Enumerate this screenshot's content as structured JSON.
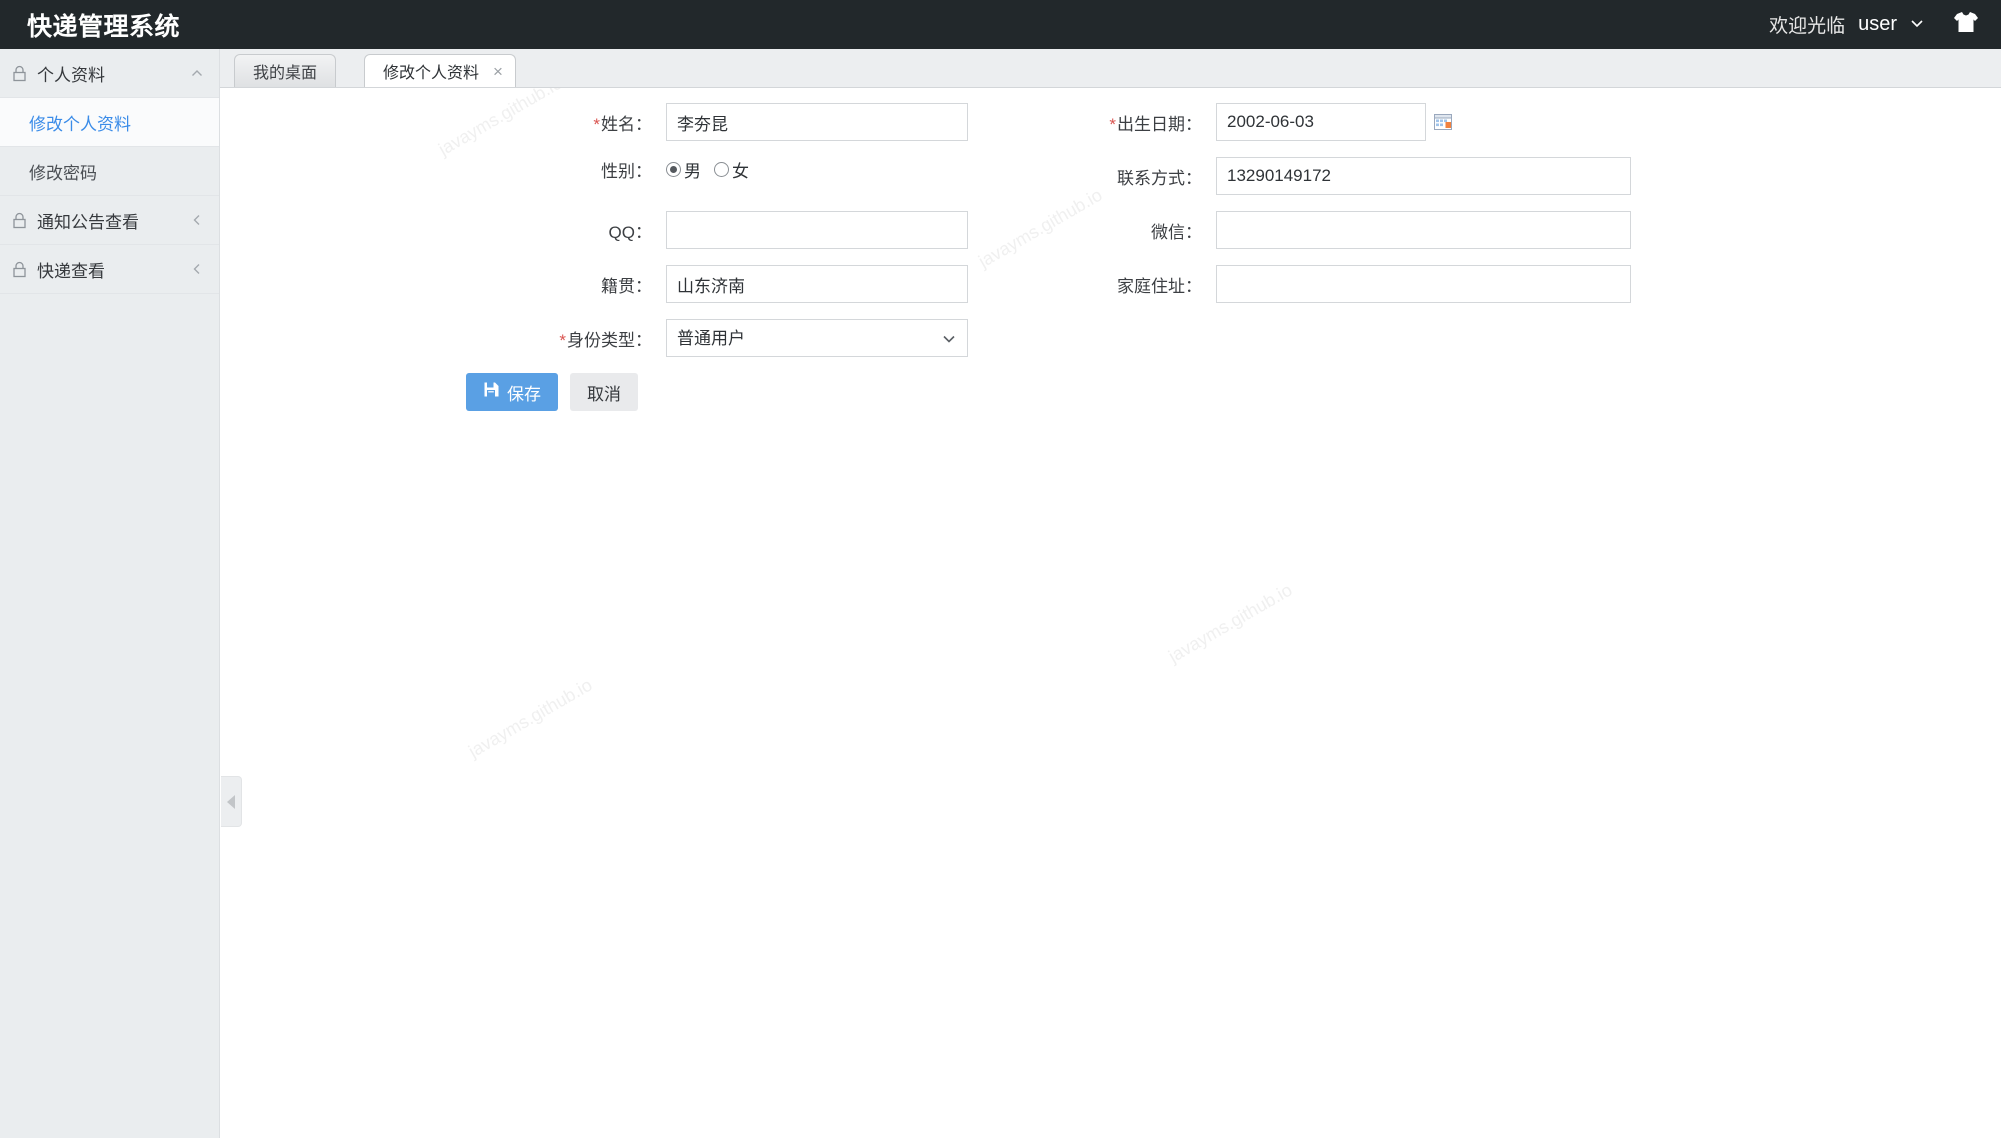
{
  "header": {
    "brand": "快递管理系统",
    "welcome": "欢迎光临",
    "user": "user",
    "caret_icon": "chevron-down-icon",
    "theme_icon": "shirt-icon"
  },
  "sidebar": {
    "groups": [
      {
        "label": "个人资料",
        "icon": "lock-icon",
        "arrow": "⌃",
        "expanded": true,
        "children": [
          {
            "label": "修改个人资料",
            "active": true
          },
          {
            "label": "修改密码",
            "active": false
          }
        ]
      },
      {
        "label": "通知公告查看",
        "icon": "lock-icon",
        "arrow": "＜",
        "expanded": false,
        "children": []
      },
      {
        "label": "快递查看",
        "icon": "lock-icon",
        "arrow": "＜",
        "expanded": false,
        "children": []
      }
    ]
  },
  "tabs": [
    {
      "label": "我的桌面",
      "active": false,
      "closable": false
    },
    {
      "label": "修改个人资料",
      "active": true,
      "closable": true,
      "close_glyph": "×"
    }
  ],
  "form": {
    "fields": {
      "name": {
        "label": "姓名：",
        "required": true,
        "value": "李夯昆",
        "placeholder": ""
      },
      "gender": {
        "label": "性别：",
        "required": false,
        "options": [
          {
            "label": "男",
            "checked": true
          },
          {
            "label": "女",
            "checked": false
          }
        ]
      },
      "qq": {
        "label": "QQ：",
        "required": false,
        "value": "",
        "placeholder": ""
      },
      "hometown": {
        "label": "籍贯：",
        "required": false,
        "value": "山东济南",
        "placeholder": ""
      },
      "identity_type": {
        "label": "身份类型：",
        "required": true,
        "value": "普通用户",
        "options": [
          "普通用户"
        ],
        "chevron_icon": "chevron-down-icon"
      },
      "birthday": {
        "label": "出生日期：",
        "required": true,
        "value": "2002-06-03",
        "placeholder": "",
        "calendar_icon": "calendar-icon"
      },
      "phone": {
        "label": "联系方式：",
        "required": false,
        "value": "13290149172",
        "placeholder": ""
      },
      "wechat": {
        "label": "微信：",
        "required": false,
        "value": "",
        "placeholder": ""
      },
      "address": {
        "label": "家庭住址：",
        "required": false,
        "value": "",
        "placeholder": ""
      }
    },
    "buttons": {
      "save": {
        "label": "保存",
        "icon": "save-icon"
      },
      "cancel": {
        "label": "取消"
      }
    }
  },
  "collapse_handle": {
    "icon": "triangle-left-icon"
  },
  "watermark": {
    "text": "javayms.github.io"
  },
  "colors": {
    "topbar_bg": "#22282b",
    "sidebar_bg": "#eaedef",
    "accent": "#3b8ce8",
    "save_button": "#5aa0e4",
    "required_star": "#d9534f"
  }
}
